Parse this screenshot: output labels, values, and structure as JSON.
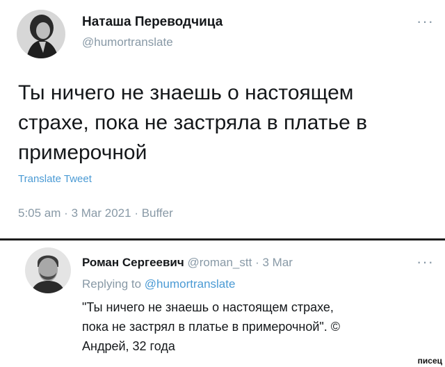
{
  "tweet": {
    "author_name": "Наташа Переводчица",
    "author_handle": "@humortranslate",
    "text_lines": [
      "Ты ничего не знаешь о настоящем",
      "страхе, пока не застряла в платье в",
      "примерочной"
    ],
    "translate_label": "Translate Tweet",
    "time": "5:05 am",
    "date": "3 Mar 2021",
    "source": "Buffer",
    "separator": "·",
    "more_glyph": "···"
  },
  "reply": {
    "author_name": "Роман Сергеевич",
    "author_handle": "@roman_stt",
    "date": "3 Mar",
    "separator": "·",
    "replying_prefix": "Replying to",
    "replying_handle": "@humortranslate",
    "text_lines": [
      "\"Ты ничего не знаешь о настоящем страхе,",
      "пока не застрял в платье в примерочной\". ©",
      "Андрей, 32 года"
    ],
    "more_glyph": "···"
  },
  "watermark": "писец",
  "colors": {
    "text": "#14171a",
    "secondary": "#8899a6",
    "link": "#4a9ad4",
    "divider": "#1c1c1c"
  }
}
